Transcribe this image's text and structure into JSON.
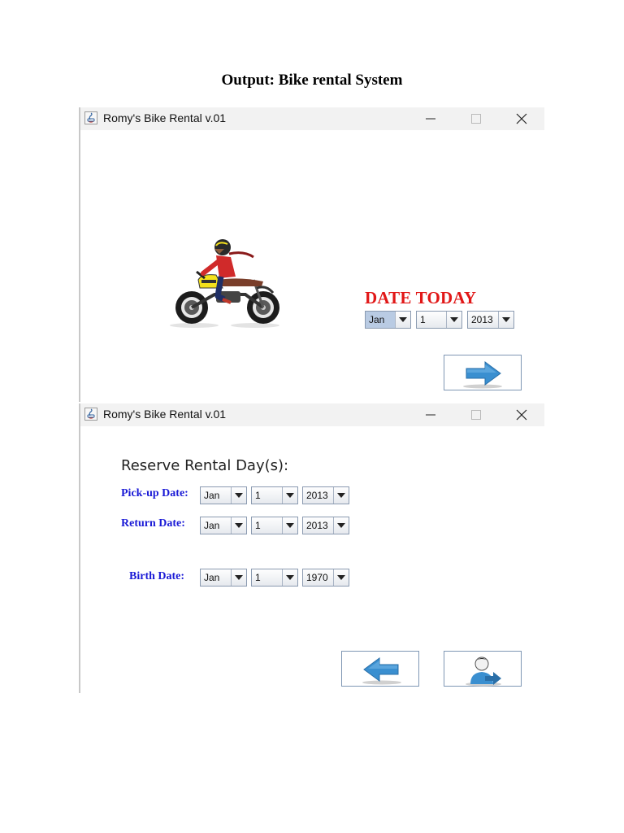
{
  "document": {
    "title": "Output: Bike rental System"
  },
  "windows": [
    {
      "title": "Romy's Bike Rental v.01",
      "date_today_label": "DATE TODAY",
      "combos": [
        {
          "value": "Jan"
        },
        {
          "value": "1"
        },
        {
          "value": "2013"
        }
      ],
      "next_button": {
        "icon": "arrow-right-icon"
      }
    },
    {
      "title": "Romy's Bike Rental v.01",
      "heading": "Reserve Rental Day(s):",
      "pickup": {
        "label": "Pick-up Date:",
        "month": "Jan",
        "day": "1",
        "year": "2013"
      },
      "return": {
        "label": "Return Date:",
        "month": "Jan",
        "day": "1",
        "year": "2013"
      },
      "birth": {
        "label": "Birth Date:",
        "month": "Jan",
        "day": "1",
        "year": "1970"
      },
      "back_button": {
        "icon": "arrow-left-icon"
      },
      "user_button": {
        "icon": "user-arrow-icon"
      }
    }
  ],
  "colors": {
    "date_today": "#e11717",
    "form_label": "#1a1ad6",
    "arrow_blue": "#3a8fd0",
    "combo_selected": "#b9cbe3"
  }
}
